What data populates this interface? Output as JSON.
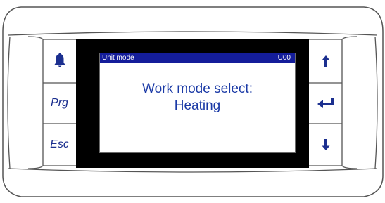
{
  "left_buttons": {
    "alarm_icon": "bell-icon",
    "prg_label": "Prg",
    "esc_label": "Esc"
  },
  "right_buttons": {
    "up_icon": "arrow-up-icon",
    "enter_icon": "enter-icon",
    "down_icon": "arrow-down-icon"
  },
  "lcd": {
    "header_title": "Unit mode",
    "header_code": "U00",
    "line1": "Work mode select:",
    "line2": "Heating"
  },
  "colors": {
    "header_bg": "#141d9a",
    "text_blue": "#1b3aa6",
    "alarm_bell": "#1b2f8f"
  }
}
